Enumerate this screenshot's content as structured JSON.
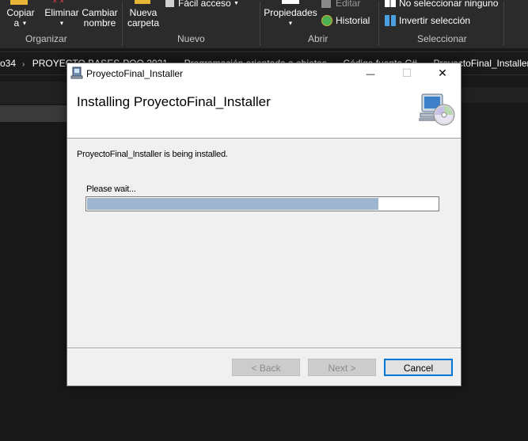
{
  "ribbon": {
    "copy_label": "Copiar\na",
    "delete_label": "Eliminar",
    "rename_label": "Cambiar\nnombre",
    "new_folder_label": "Nueva\ncarpeta",
    "easy_access_label": "Fácil acceso",
    "properties_label": "Propiedades",
    "edit_label": "Editar",
    "history_label": "Historial",
    "select_none_label": "No seleccionar ninguno",
    "invert_selection_label": "Invertir selección",
    "group_organize": "Organizar",
    "group_new": "Nuevo",
    "group_open": "Abrir",
    "group_select": "Seleccionar"
  },
  "breadcrumbs": [
    "o34",
    "PROYECTO BASES-POO 2021",
    "Programación orientada a objetos",
    "Código fuente C#",
    "ProyectoFinal_Installer"
  ],
  "installer": {
    "window_title": "ProyectoFinal_Installer",
    "header_title": "Installing ProyectoFinal_Installer",
    "status_message": "ProyectoFinal_Installer is being installed.",
    "wait_label": "Please wait...",
    "progress_fraction": 0.83,
    "back_label": "< Back",
    "next_label": "Next >",
    "cancel_label": "Cancel",
    "minimize_glyph": "—",
    "maximize_glyph": "☐",
    "close_glyph": "✕"
  },
  "colors": {
    "accent": "#0078d7",
    "progress_fill": "#9db5cf",
    "explorer_bg": "#191919",
    "ribbon_bg": "#2b2b2b"
  }
}
